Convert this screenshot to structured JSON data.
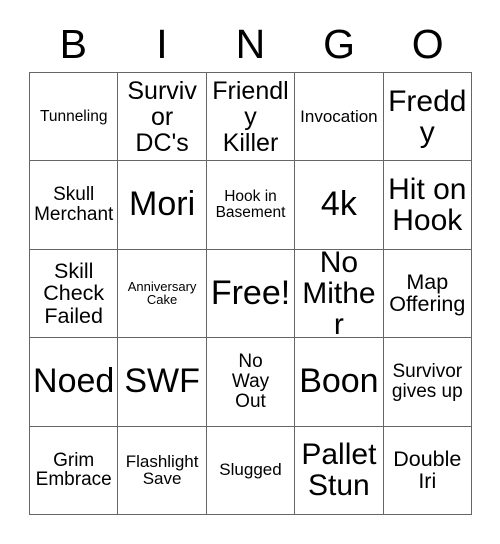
{
  "card": {
    "title": "BINGO",
    "header_letters": [
      "B",
      "I",
      "N",
      "G",
      "O"
    ],
    "grid_size": "5x5",
    "colors": {
      "background": "#ffffff",
      "text": "#000000",
      "grid_line": "#666666"
    },
    "rows": [
      [
        {
          "label": "Tunneling",
          "size": "s-sm"
        },
        {
          "label": "Survivor\nDC's",
          "size": "s-lg"
        },
        {
          "label": "Friendly\nKiller",
          "size": "s-lg"
        },
        {
          "label": "Invocation",
          "size": "s-smd"
        },
        {
          "label": "Freddy",
          "size": "s-xl"
        }
      ],
      [
        {
          "label": "Skull\nMerchant",
          "size": "s-md"
        },
        {
          "label": "Mori",
          "size": "s-xxl"
        },
        {
          "label": "Hook in\nBasement",
          "size": "s-sm"
        },
        {
          "label": "4k",
          "size": "s-xxl"
        },
        {
          "label": "Hit on\nHook",
          "size": "s-xl"
        }
      ],
      [
        {
          "label": "Skill\nCheck\nFailed",
          "size": "s-mdl"
        },
        {
          "label": "Anniversary\nCake",
          "size": "s-xs"
        },
        {
          "label": "Free!",
          "size": "s-xxl"
        },
        {
          "label": "No\nMither",
          "size": "s-xl"
        },
        {
          "label": "Map\nOffering",
          "size": "s-mdl"
        }
      ],
      [
        {
          "label": "Noed",
          "size": "s-xxl"
        },
        {
          "label": "SWF",
          "size": "s-xxl"
        },
        {
          "label": "No\nWay\nOut",
          "size": "s-md"
        },
        {
          "label": "Boon",
          "size": "s-xxl"
        },
        {
          "label": "Survivor\ngives up",
          "size": "s-md"
        }
      ],
      [
        {
          "label": "Grim\nEmbrace",
          "size": "s-md"
        },
        {
          "label": "Flashlight\nSave",
          "size": "s-smd"
        },
        {
          "label": "Slugged",
          "size": "s-smd"
        },
        {
          "label": "Pallet\nStun",
          "size": "s-xl"
        },
        {
          "label": "Double\nIri",
          "size": "s-mdl"
        }
      ]
    ]
  }
}
